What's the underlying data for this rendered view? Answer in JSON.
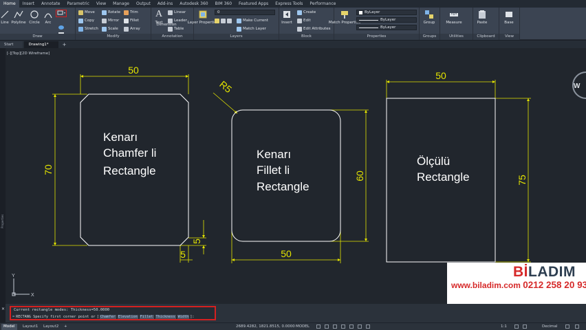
{
  "menu_tabs": [
    "Home",
    "Insert",
    "Annotate",
    "Parametric",
    "View",
    "Manage",
    "Output",
    "Add-ins",
    "Autodesk 360",
    "BIM 360",
    "Featured Apps",
    "Express Tools",
    "Performance"
  ],
  "ribbon": {
    "draw": {
      "title": "Draw",
      "line": "Line",
      "polyline": "Polyline",
      "circle": "Circle",
      "arc": "Arc"
    },
    "modify": {
      "title": "Modify",
      "move": "Move",
      "rotate": "Rotate",
      "trim": "Trim",
      "copy": "Copy",
      "mirror": "Mirror",
      "fillet": "Fillet",
      "stretch": "Stretch",
      "scale": "Scale",
      "array": "Array"
    },
    "annotation": {
      "title": "Annotation",
      "text": "Text",
      "dimension": "Dimension",
      "linear": "Linear",
      "leader": "Leader",
      "table": "Table"
    },
    "layers": {
      "title": "Layers",
      "layer_properties": "Layer Properties",
      "layer_value": "0",
      "make_current": "Make Current",
      "match_layer": "Match Layer"
    },
    "block": {
      "title": "Block",
      "insert": "Insert",
      "create": "Create",
      "edit": "Edit",
      "edit_attributes": "Edit Attributes"
    },
    "properties": {
      "title": "Properties",
      "match_properties": "Match Properties",
      "color": "ByLayer",
      "linetype": "ByLayer",
      "lineweight": "ByLayer"
    },
    "groups": {
      "title": "Groups",
      "group": "Group"
    },
    "utilities": {
      "title": "Utilities",
      "measure": "Measure"
    },
    "clipboard": {
      "title": "Clipboard",
      "paste": "Paste"
    },
    "view": {
      "title": "View",
      "base": "Base"
    }
  },
  "doc_tabs": {
    "start": "Start",
    "drawing": "Drawing1*",
    "plus": "+"
  },
  "viewport": {
    "label": "[-][Top][2D Wireframe]",
    "side_label": "Properties",
    "viewcube_letter": "W"
  },
  "drawing": {
    "rect1": {
      "lines": [
        "Kenarı",
        "Chamfer li",
        "Rectangle"
      ],
      "width_dim": "50",
      "height_dim": "70",
      "chamfer_v": "5",
      "chamfer_h": "5"
    },
    "rect2": {
      "lines": [
        "Kenarı",
        "Fillet li",
        "Rectangle"
      ],
      "radius_dim": "R5",
      "height_dim": "60",
      "width_dim": "50"
    },
    "rect3": {
      "lines": [
        "Ölçülü",
        "Rectangle"
      ],
      "width_dim": "50",
      "height_dim": "75"
    },
    "ucs": {
      "x": "X",
      "y": "Y"
    }
  },
  "brand": {
    "prefix": "Bİ",
    "rest": "LADIM",
    "website": "www.biladim.com",
    "phone": "0212 258 20 93"
  },
  "command": {
    "history": "Current rectangle modes:  Thickness=50.0000",
    "prompt": "RECTANG Specify first corner point or",
    "options": [
      "Chamfer",
      "Elevation",
      "Fillet",
      "Thickness",
      "Width"
    ],
    "tail": "]:"
  },
  "status": {
    "model_tab": "Model",
    "layout1": "Layout1",
    "layout2": "Layout2",
    "coords": "2689.4282, 1821.8515, 0.0000",
    "space": "MODEL",
    "scale": "1:1",
    "units": "Decimal"
  },
  "colors": {
    "dim": "#e5e500",
    "geometry": "#ffffff",
    "command_highlight": "#d52020",
    "brand_red": "#d62a2a",
    "brand_dark": "#2d3e50"
  }
}
